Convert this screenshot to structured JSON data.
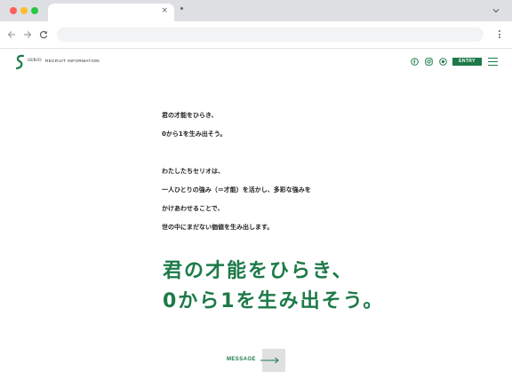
{
  "browser": {
    "tab_close_glyph": "×",
    "new_tab_glyph": "·",
    "icons": [
      "back-arrow-icon",
      "forward-arrow-icon",
      "reload-icon",
      "kebab-menu-icon",
      "chevron-down-icon"
    ]
  },
  "header": {
    "logo_text": "SERIO",
    "section_label": "RECRUIT INFORMATION",
    "entry_label": "ENTRY",
    "social_icons": [
      "facebook-icon",
      "instagram-icon",
      "line-icon"
    ]
  },
  "intro": {
    "lines": [
      "君の才能をひらき、",
      "0から1を生み出そう。",
      "わたしたちセリオは、",
      "一人ひとりの強み（＝才能）を活かし、多彩な強みを",
      "かけあわせることで、",
      "世の中にまだない価値を生み出します。"
    ]
  },
  "headline": {
    "line1": "君の才能をひらき、",
    "line2": "0から1を生み出そう。"
  },
  "message_link": {
    "label": "MESSAGE"
  },
  "colors": {
    "brand_green": "#1d7a48",
    "chrome_bar": "#dedfe3",
    "address_bar": "#f1f3f4"
  }
}
